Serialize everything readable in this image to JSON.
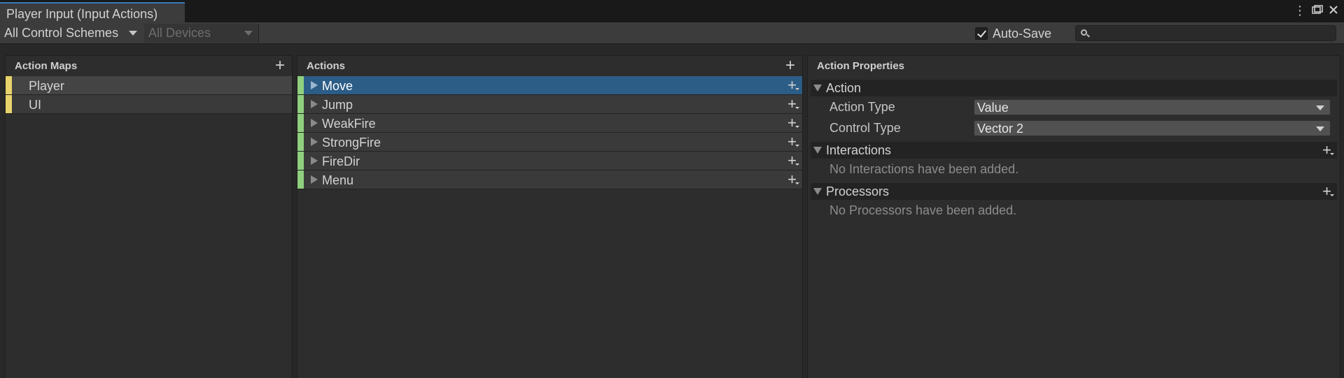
{
  "window": {
    "tab_title": "Player Input (Input Actions)",
    "menu_icon": "kebab-menu-icon",
    "maximize_icon": "maximize-icon",
    "close_icon": "close-icon"
  },
  "toolbar": {
    "control_schemes": "All Control Schemes",
    "devices": "All Devices",
    "auto_save_label": "Auto-Save",
    "auto_save_checked": true,
    "search_value": "",
    "search_icon": "search-icon"
  },
  "action_maps": {
    "title": "Action Maps",
    "items": [
      {
        "label": "Player",
        "selected": true
      },
      {
        "label": "UI",
        "selected": false
      }
    ],
    "strip_color": "#e9d36c"
  },
  "actions": {
    "title": "Actions",
    "items": [
      {
        "label": "Move",
        "selected": true
      },
      {
        "label": "Jump",
        "selected": false
      },
      {
        "label": "WeakFire",
        "selected": false
      },
      {
        "label": "StrongFire",
        "selected": false
      },
      {
        "label": "FireDir",
        "selected": false
      },
      {
        "label": "Menu",
        "selected": false
      }
    ],
    "strip_color": "#8fcf7e",
    "selected_color": "#2c5d87"
  },
  "properties": {
    "title": "Action Properties",
    "action_section": "Action",
    "action_type_label": "Action Type",
    "action_type_value": "Value",
    "control_type_label": "Control Type",
    "control_type_value": "Vector 2",
    "interactions_section": "Interactions",
    "interactions_empty": "No Interactions have been added.",
    "processors_section": "Processors",
    "processors_empty": "No Processors have been added."
  }
}
